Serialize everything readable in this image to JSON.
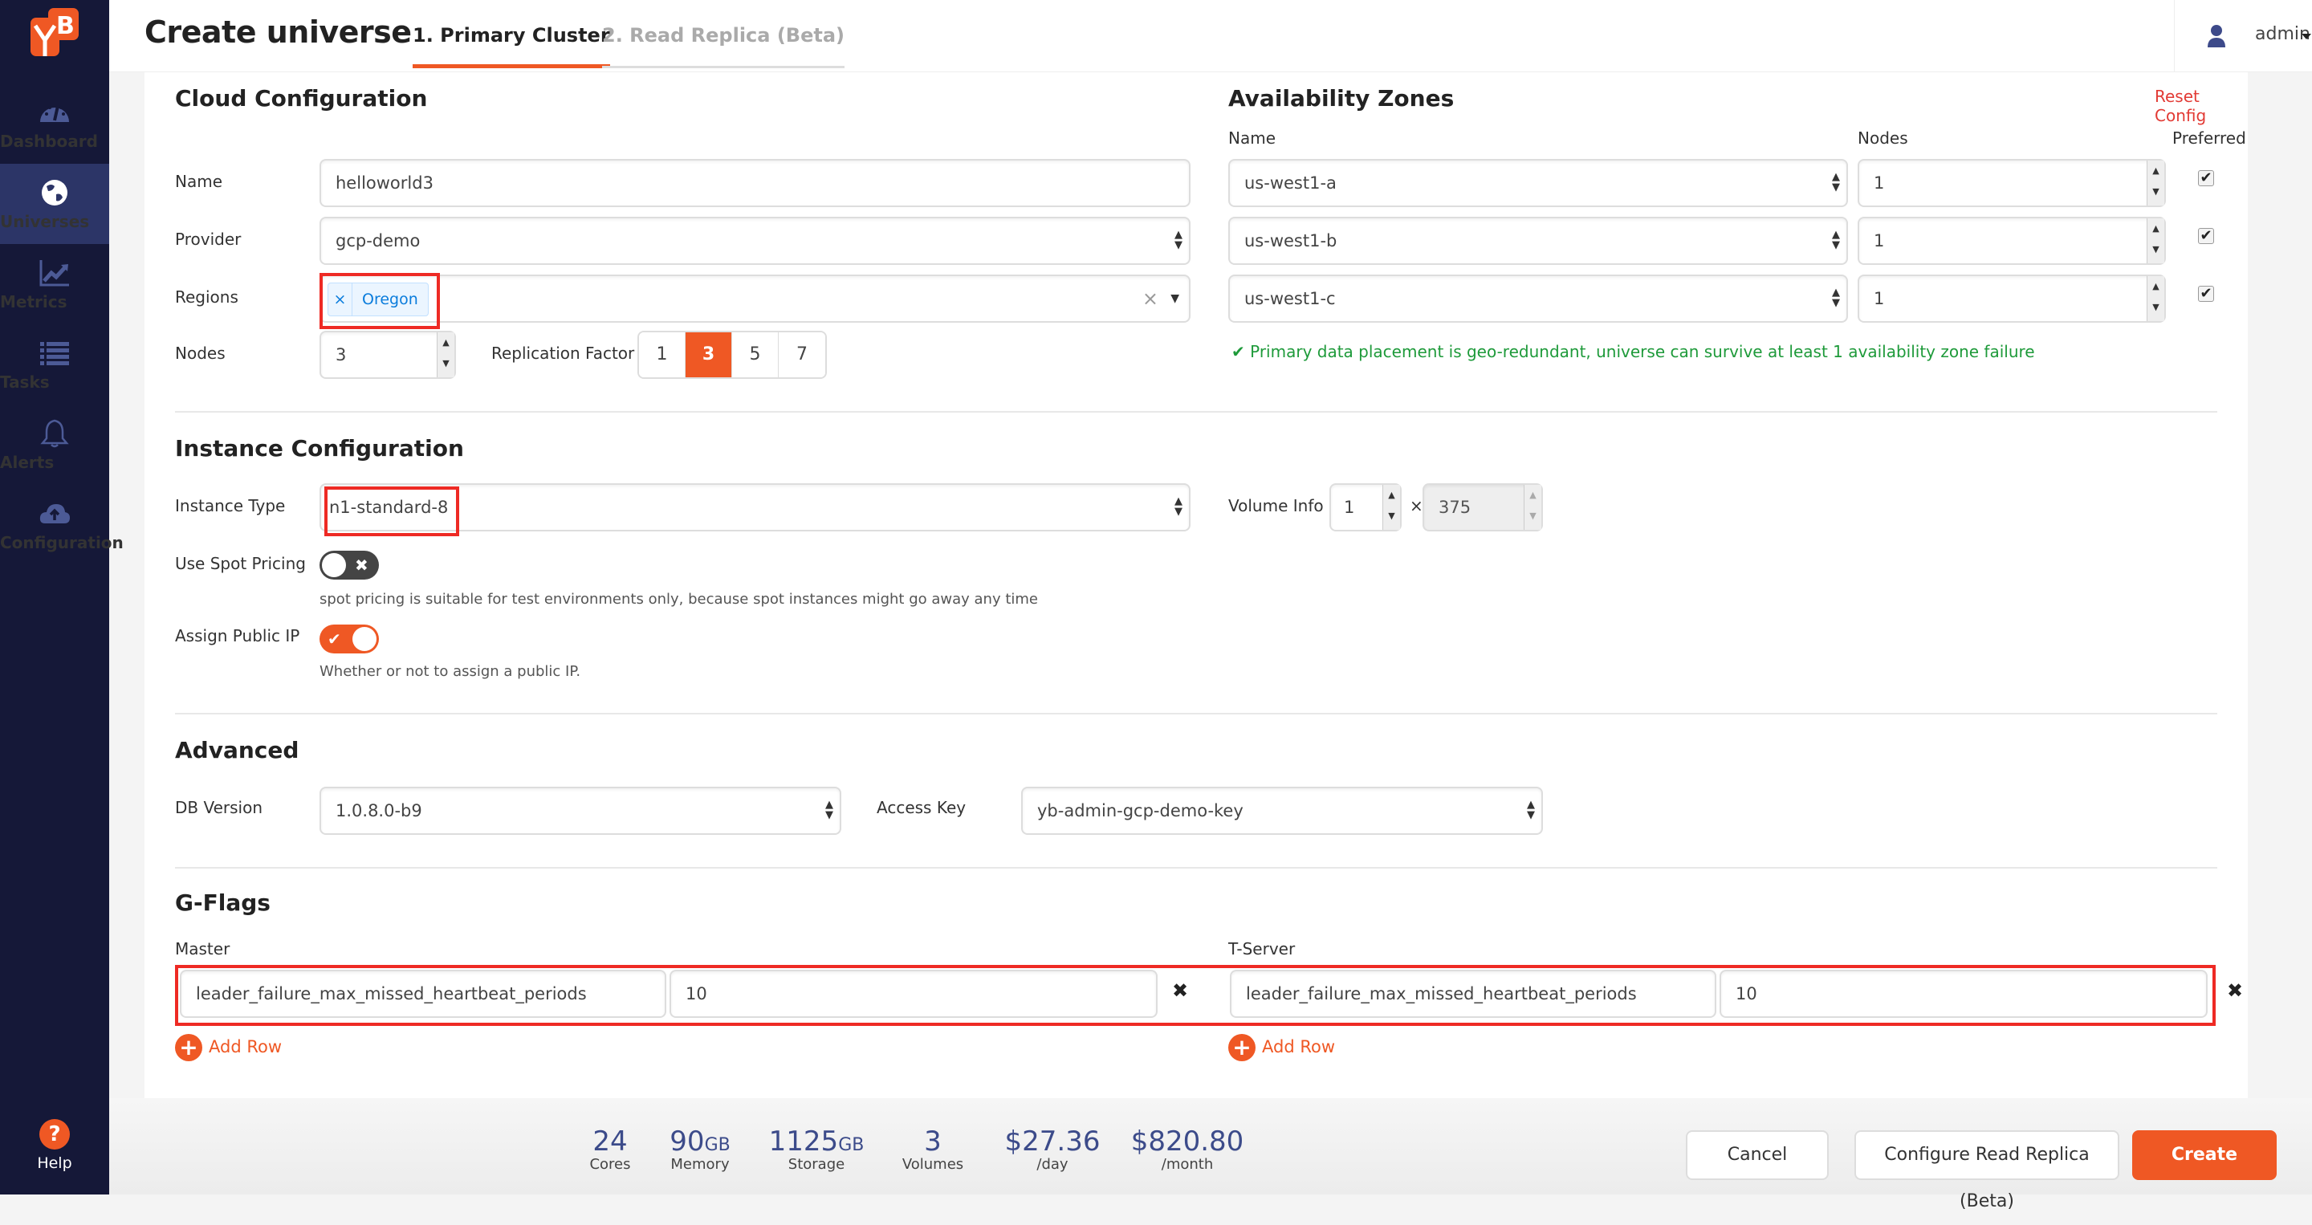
{
  "app": {
    "logo_text": "YB"
  },
  "sidebar": {
    "items": [
      {
        "label": "Dashboard",
        "icon": "dashboard-gauge-icon"
      },
      {
        "label": "Universes",
        "icon": "globe-icon",
        "active": true
      },
      {
        "label": "Metrics",
        "icon": "line-chart-icon"
      },
      {
        "label": "Tasks",
        "icon": "list-icon"
      },
      {
        "label": "Alerts",
        "icon": "bell-icon"
      },
      {
        "label": "Configuration",
        "icon": "cloud-upload-icon"
      }
    ],
    "help_label": "Help"
  },
  "header": {
    "title": "Create universe",
    "tabs": [
      {
        "label": "1. Primary Cluster",
        "active": true
      },
      {
        "label": "2. Read Replica (Beta)",
        "active": false
      }
    ],
    "user": "admin"
  },
  "cloud": {
    "title": "Cloud Configuration",
    "name_label": "Name",
    "name_value": "helloworld3",
    "provider_label": "Provider",
    "provider_value": "gcp-demo",
    "regions_label": "Regions",
    "region_tags": [
      "Oregon"
    ],
    "region_tag_remove": "×",
    "regions_clear": "×",
    "nodes_label": "Nodes",
    "nodes_value": "3",
    "rf_label": "Replication Factor",
    "rf_options": [
      "1",
      "3",
      "5",
      "7"
    ],
    "rf_selected": "3"
  },
  "az": {
    "title": "Availability Zones",
    "reset_label": "Reset Config",
    "col_name": "Name",
    "col_nodes": "Nodes",
    "col_preferred": "Preferred",
    "rows": [
      {
        "zone": "us-west1-a",
        "nodes": "1",
        "preferred": true
      },
      {
        "zone": "us-west1-b",
        "nodes": "1",
        "preferred": true
      },
      {
        "zone": "us-west1-c",
        "nodes": "1",
        "preferred": true
      }
    ],
    "status": "Primary data placement is geo-redundant, universe can survive at least 1 availability zone failure",
    "status_color": "#1e9a3a"
  },
  "instance": {
    "title": "Instance Configuration",
    "type_label": "Instance Type",
    "type_value": "n1-standard-8",
    "volume_label": "Volume Info",
    "volume_count": "1",
    "volume_times": "×",
    "volume_size": "375",
    "spot_label": "Use Spot Pricing",
    "spot_on": false,
    "spot_hint": "spot pricing is suitable for test environments only, because spot instances might go away any time",
    "public_ip_label": "Assign Public IP",
    "public_ip_on": true,
    "public_ip_hint": "Whether or not to assign a public IP."
  },
  "advanced": {
    "title": "Advanced",
    "db_version_label": "DB Version",
    "db_version_value": "1.0.8.0-b9",
    "access_key_label": "Access Key",
    "access_key_value": "yb-admin-gcp-demo-key"
  },
  "gflags": {
    "title": "G-Flags",
    "master_label": "Master",
    "tserver_label": "T-Server",
    "master_rows": [
      {
        "flag": "leader_failure_max_missed_heartbeat_periods",
        "value": "10"
      }
    ],
    "tserver_rows": [
      {
        "flag": "leader_failure_max_missed_heartbeat_periods",
        "value": "10"
      }
    ],
    "remove_symbol": "✖",
    "add_row_label": "Add Row"
  },
  "footer": {
    "stats": [
      {
        "value": "24",
        "unit": "",
        "caption": "Cores"
      },
      {
        "value": "90",
        "unit": "GB",
        "caption": "Memory"
      },
      {
        "value": "1125",
        "unit": "GB",
        "caption": "Storage"
      },
      {
        "value": "3",
        "unit": "",
        "caption": "Volumes"
      },
      {
        "value": "$27.36",
        "unit": "",
        "caption": "/day"
      },
      {
        "value": "$820.80",
        "unit": "",
        "caption": "/month"
      }
    ],
    "cancel_label": "Cancel",
    "read_replica_label": "Configure Read Replica (Beta)",
    "create_label": "Create"
  },
  "colors": {
    "accent": "#ef5824",
    "sidebar": "#151838",
    "sidebar_active": "#2c3567",
    "highlight": "#ee2a24"
  }
}
